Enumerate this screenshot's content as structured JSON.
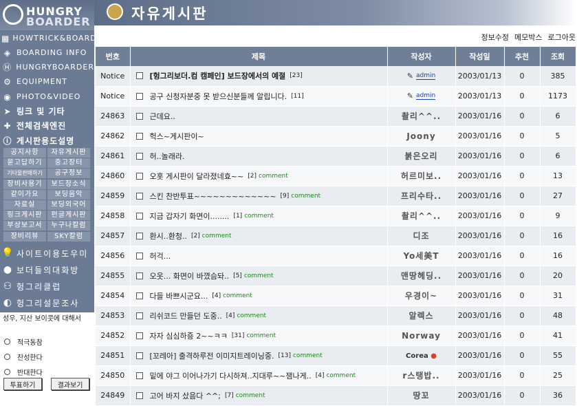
{
  "brand": {
    "line1": "HUNGRY",
    "line2": "BOARDER"
  },
  "header": {
    "title": "자유게시판"
  },
  "toplinks": [
    "정보수정",
    "메모박스",
    "로그아웃"
  ],
  "nav": [
    {
      "label": "HOWTRICK&BOARD",
      "icon": "grid-icon"
    },
    {
      "label": "BOARDING INFO",
      "icon": "diamond-icon"
    },
    {
      "label": "HUNGRYBOARDER",
      "icon": "h-logo-icon"
    },
    {
      "label": "EQUIPMENT",
      "icon": "gear-icon"
    },
    {
      "label": "PHOTO&VIDEO",
      "icon": "camera-icon"
    },
    {
      "label": "링크 및 기타",
      "icon": "arrow-icon"
    },
    {
      "label": "전체검색엔진",
      "icon": "search-icon"
    },
    {
      "label": "게시판용도설명",
      "icon": "info-icon"
    }
  ],
  "gridmenu": [
    "공지사항",
    "자유게시판",
    "묻고답하기",
    "중고장터",
    "기타물판매하기",
    "공구정보",
    "장비사용기",
    "보드장소식",
    "같이가요",
    "보딩음악",
    "자료실",
    "보딩외국어",
    "링크게시판",
    "펀글게시판",
    "부상보고서",
    "누구나칼럼",
    "장비리뷰",
    "SKY칼럼"
  ],
  "subnav": [
    {
      "label": "사이트이용도우미",
      "icon": "bulb-icon"
    },
    {
      "label": "보더들의대화방",
      "icon": "person-icon"
    },
    {
      "label": "헝그리클럽",
      "icon": "group-icon"
    },
    {
      "label": "헝그리설문조사",
      "icon": "poll-icon"
    }
  ],
  "poll": {
    "question": "성우, 지산 보이콧에 대해서",
    "options": [
      "적극동참",
      "찬성한다",
      "반대한다"
    ],
    "vote_button": "투표하기",
    "result_button": "결과보기"
  },
  "table": {
    "headers": [
      "번호",
      "제목",
      "작성자",
      "작성일",
      "추천",
      "조회"
    ],
    "rows": [
      {
        "no": "Notice",
        "title": "[헝그리보더.컴 캠페인] 보드장에서의 예절",
        "count": "[23]",
        "comment": "",
        "author": "admin",
        "date": "2003/01/13",
        "rec": "0",
        "views": "385",
        "bold": true
      },
      {
        "no": "Notice",
        "title": "공구 신청자분중 못 받으신분들께 알립니다.",
        "count": "[11]",
        "comment": "",
        "author": "admin",
        "date": "2003/01/13",
        "rec": "0",
        "views": "1173",
        "bold": false
      },
      {
        "no": "24863",
        "title": "근데요..",
        "count": "",
        "comment": "",
        "author": "촬리^^..",
        "date": "2003/01/16",
        "rec": "0",
        "views": "6",
        "bold": false
      },
      {
        "no": "24862",
        "title": "헉스~게시판이~",
        "count": "",
        "comment": "",
        "author": "Joony",
        "date": "2003/01/16",
        "rec": "0",
        "views": "5",
        "bold": false
      },
      {
        "no": "24861",
        "title": "허..놀래라.",
        "count": "",
        "comment": "",
        "author": "붉은오리",
        "date": "2003/01/16",
        "rec": "0",
        "views": "6",
        "bold": false
      },
      {
        "no": "24860",
        "title": "오홋 게시판이 달라졌네효~~",
        "count": "[2]",
        "comment": "comment",
        "author": "허르미보..",
        "date": "2003/01/16",
        "rec": "0",
        "views": "13",
        "bold": false
      },
      {
        "no": "24859",
        "title": "스킨 찬반투표~~~~~~~~~~~~~",
        "count": "[9]",
        "comment": "comment",
        "author": "프리수타..",
        "date": "2003/01/16",
        "rec": "0",
        "views": "27",
        "bold": false
      },
      {
        "no": "24858",
        "title": "지금 갑자기 화면이........",
        "count": "[1]",
        "comment": "comment",
        "author": "촬리^^..",
        "date": "2003/01/16",
        "rec": "0",
        "views": "9",
        "bold": false
      },
      {
        "no": "24857",
        "title": "환시..환청..",
        "count": "[2]",
        "comment": "comment",
        "author": "디조",
        "date": "2003/01/16",
        "rec": "0",
        "views": "16",
        "bold": false
      },
      {
        "no": "24856",
        "title": "허걱...",
        "count": "",
        "comment": "",
        "author": "Yo세美T",
        "date": "2003/01/16",
        "rec": "0",
        "views": "16",
        "bold": false
      },
      {
        "no": "24855",
        "title": "오옷... 화면이 바꼈슴돠..",
        "count": "[5]",
        "comment": "comment",
        "author": "맨땅헤딩..",
        "date": "2003/01/16",
        "rec": "0",
        "views": "20",
        "bold": false
      },
      {
        "no": "24854",
        "title": "다들 바쁘시군요...",
        "count": "[4]",
        "comment": "comment",
        "author": "우경이~",
        "date": "2003/01/16",
        "rec": "0",
        "views": "31",
        "bold": false
      },
      {
        "no": "24853",
        "title": "리쉬코드 만들던 도중..",
        "count": "[4]",
        "comment": "comment",
        "author": "알렉스",
        "date": "2003/01/16",
        "rec": "0",
        "views": "48",
        "bold": false
      },
      {
        "no": "24852",
        "title": "자자 심심하죵 2~~ㅋㅋ",
        "count": "[31]",
        "comment": "comment",
        "author": "Norway",
        "date": "2003/01/16",
        "rec": "0",
        "views": "41",
        "bold": false
      },
      {
        "no": "24851",
        "title": "[꼬레아] 출격하루전 이미지트레이닝중.",
        "count": "[13]",
        "comment": "comment",
        "author": "Corea",
        "date": "2003/01/16",
        "rec": "0",
        "views": "55",
        "bold": false
      },
      {
        "no": "24850",
        "title": "밑에 야그 이어나가기 다시하져..지대루~~잼나게..",
        "count": "[4]",
        "comment": "comment",
        "author": "r스탱밥..",
        "date": "2003/01/16",
        "rec": "0",
        "views": "25",
        "bold": false
      },
      {
        "no": "24849",
        "title": "고어 바지 샀음다 ^^;",
        "count": "[7]",
        "comment": "comment",
        "author": "땅꼬",
        "date": "2003/01/16",
        "rec": "0",
        "views": "36",
        "bold": false
      }
    ]
  },
  "colors": {
    "sidebar": "#6b7b94",
    "header_row": "#6f7f97",
    "comment": "#1a8a1a"
  }
}
